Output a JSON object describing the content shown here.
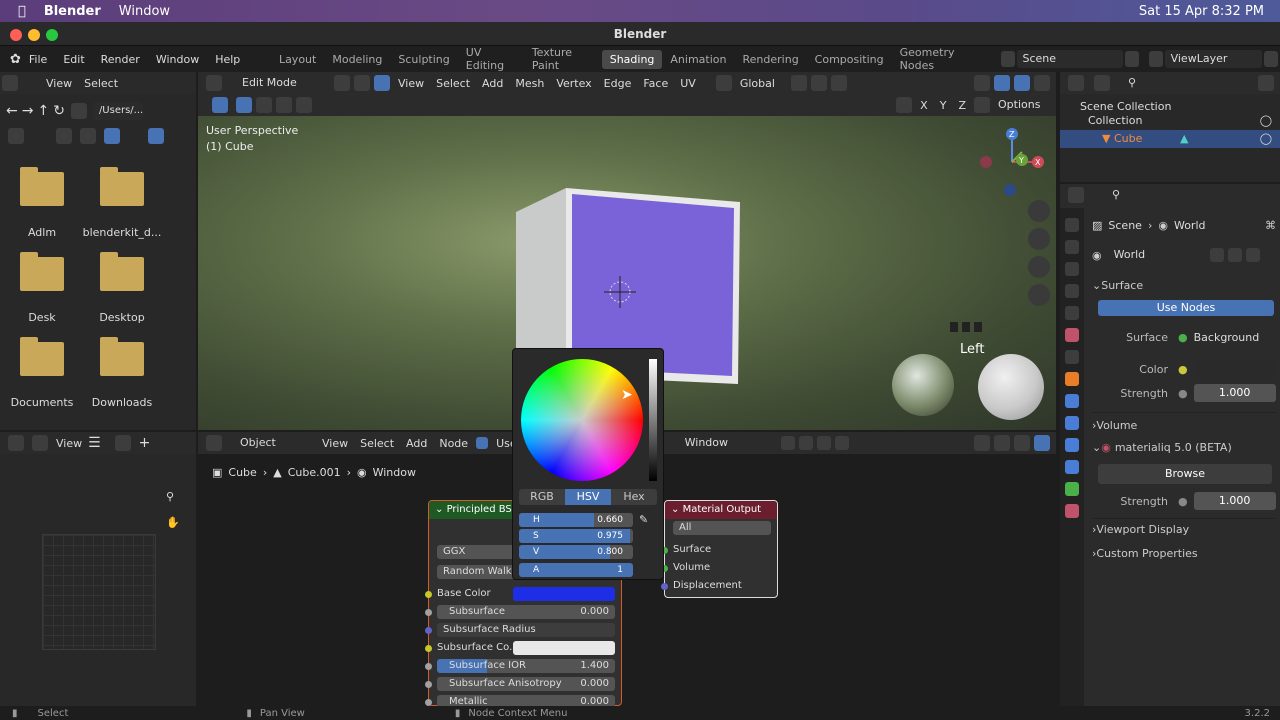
{
  "macbar": {
    "app": "Blender",
    "menu": "Window",
    "datetime": "Sat 15 Apr  8:32 PM"
  },
  "window": {
    "title": "Blender"
  },
  "topmenu": {
    "items": [
      "File",
      "Edit",
      "Render",
      "Window",
      "Help"
    ]
  },
  "workspaces": [
    "Layout",
    "Modeling",
    "Sculpting",
    "UV Editing",
    "Texture Paint",
    "Shading",
    "Animation",
    "Rendering",
    "Compositing",
    "Geometry Nodes"
  ],
  "active_workspace": "Shading",
  "scene": "Scene",
  "view_layer": "ViewLayer",
  "filebrowser": {
    "menu": [
      "View",
      "Select"
    ],
    "path": "/Users/...",
    "folders": [
      "Adlm",
      "blenderkit_d...",
      "Desk",
      "Desktop",
      "Documents",
      "Downloads"
    ]
  },
  "viewport": {
    "mode": "Edit Mode",
    "menu": [
      "View",
      "Select",
      "Add",
      "Mesh",
      "Vertex",
      "Edge",
      "Face",
      "UV"
    ],
    "transform": "Global",
    "options": "Options",
    "axes": [
      "X",
      "Y",
      "Z"
    ],
    "perspective": "User Perspective",
    "object": "(1) Cube",
    "left_label": "Left"
  },
  "outliner": {
    "scene_collection": "Scene Collection",
    "collection": "Collection",
    "cube": "Cube"
  },
  "properties": {
    "breadcrumb": [
      "Scene",
      "World"
    ],
    "world": "World",
    "surface_section": "Surface",
    "use_nodes": "Use Nodes",
    "surface_label": "Surface",
    "surface_value": "Background",
    "color_label": "Color",
    "strength_label": "Strength",
    "strength_value": "1.000",
    "volume": "Volume",
    "materialiq": "materialiq 5.0 (BETA)",
    "browse": "Browse",
    "strength2_label": "Strength",
    "strength2_value": "1.000",
    "viewport_display": "Viewport Display",
    "custom_props": "Custom Properties"
  },
  "nodeeditor": {
    "object_mode": "Object",
    "menu": [
      "View",
      "Select",
      "Add",
      "Node"
    ],
    "use": "Use",
    "world_field": "Window",
    "breadcrumb": [
      "Cube",
      "Cube.001",
      "Window"
    ],
    "view_label": "View"
  },
  "bsdf": {
    "title": "Principled BSDF",
    "distribution": "GGX",
    "subsurface_method": "Random Walk",
    "rows": [
      {
        "label": "Base Color",
        "value": ""
      },
      {
        "label": "Subsurface",
        "value": "0.000"
      },
      {
        "label": "Subsurface Radius",
        "value": ""
      },
      {
        "label": "Subsurface Co...",
        "value": ""
      },
      {
        "label": "Subsurface IOR",
        "value": "1.400"
      },
      {
        "label": "Subsurface Anisotropy",
        "value": "0.000"
      },
      {
        "label": "Metallic",
        "value": "0.000"
      }
    ]
  },
  "matout": {
    "title": "Material Output",
    "target": "All",
    "inputs": [
      "Surface",
      "Volume",
      "Displacement"
    ]
  },
  "colorpicker": {
    "tabs": [
      "RGB",
      "HSV",
      "Hex"
    ],
    "active": "HSV",
    "H": {
      "label": "H",
      "value": "0.660",
      "level": 0.66
    },
    "S": {
      "label": "S",
      "value": "0.975",
      "level": 0.975
    },
    "V": {
      "label": "V",
      "value": "0.800",
      "level": 0.8
    },
    "A": {
      "label": "A",
      "value": "1",
      "level": 1.0
    }
  },
  "status": {
    "left": "Select",
    "middle": "Pan View",
    "right": "Node Context Menu",
    "version": "3.2.2"
  },
  "colors": {
    "accent": "#4772b3",
    "purple": "#7a62d8",
    "basecolor": "#1e2de6",
    "node_header_green": "#1f5a25",
    "node_header_red": "#6b1e2e"
  }
}
